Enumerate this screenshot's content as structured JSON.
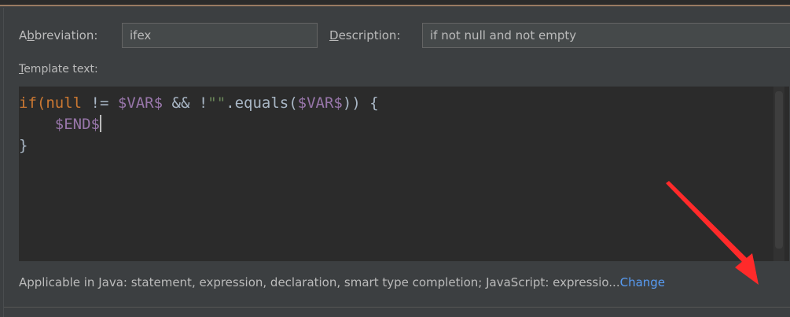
{
  "abbreviation": {
    "label_prefix": "A",
    "label_mnemonic": "b",
    "label_suffix": "breviation:",
    "value": "ifex"
  },
  "description": {
    "label_mnemonic": "D",
    "label_suffix": "escription:",
    "value": "if not null and not empty"
  },
  "template_text": {
    "label_mnemonic": "T",
    "label_suffix": "emplate text:",
    "line1": {
      "if_open": "if(",
      "null_kw": "null",
      "neq": " != ",
      "var1": "$VAR$",
      "and": " && !",
      "str": "\"\"",
      "equals": ".equals(",
      "var2": "$VAR$",
      "close": ")) {"
    },
    "line2": {
      "indent": "    ",
      "end_var": "$END$"
    },
    "line3": "}"
  },
  "applicable": {
    "text": "Applicable in Java: statement, expression, declaration, smart type completion; JavaScript: expressio...",
    "change_link": "Change"
  },
  "colors": {
    "background": "#3c3f41",
    "editor_background": "#2b2b2b",
    "keyword": "#cc7832",
    "variable": "#9876aa",
    "link": "#589df6",
    "annotation_arrow": "#ff2a2a"
  }
}
